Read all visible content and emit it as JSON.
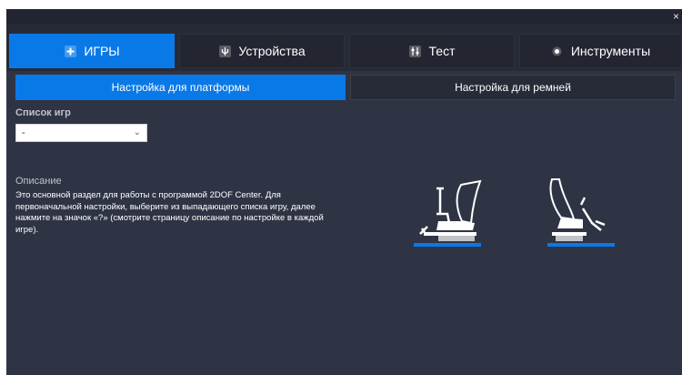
{
  "window": {
    "close_label": "×"
  },
  "main_tabs": [
    {
      "label": "ИГРЫ",
      "icon": "gamepad-icon",
      "active": true
    },
    {
      "label": "Устройства",
      "icon": "device-icon",
      "active": false
    },
    {
      "label": "Тест",
      "icon": "sliders-icon",
      "active": false
    },
    {
      "label": "Инструменты",
      "icon": "gear-icon",
      "active": false
    }
  ],
  "sub_tabs": [
    {
      "label": "Настройка для платформы",
      "active": true
    },
    {
      "label": "Настройка для ремней",
      "active": false
    }
  ],
  "games": {
    "label": "Список игр",
    "selected": "-"
  },
  "description": {
    "label": "Описание",
    "text": "Это основной раздел для работы с программой 2DOF Center. Для первоначальной настройки, выберите из выпадающего списка игру, далее нажмите на значок «?» (смотрите страницу описание по настройке в каждой игре)."
  },
  "colors": {
    "accent": "#0a79e8",
    "background": "#2f3445",
    "tab_bar": "#262a36"
  }
}
